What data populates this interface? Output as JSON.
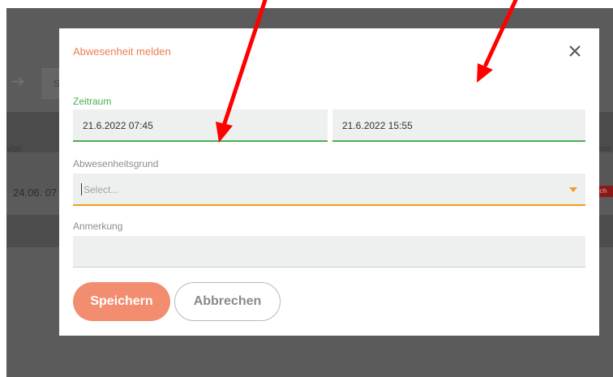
{
  "background": {
    "row_label_von": "Von",
    "row_date": "24.06. 07",
    "box_char": "S",
    "right_col": "atus",
    "badge": "ich"
  },
  "modal": {
    "title": "Abwesenheit melden",
    "period": {
      "label": "Zeitraum",
      "from_value": "21.6.2022 07:45",
      "to_value": "21.6.2022 15:55"
    },
    "reason": {
      "label": "Abwesenheitsgrund",
      "placeholder": "Select..."
    },
    "note": {
      "label": "Anmerkung",
      "value": ""
    },
    "buttons": {
      "save": "Speichern",
      "cancel": "Abbrechen"
    }
  },
  "colors": {
    "accent_orange": "#ee7b52",
    "focus_green": "#4caf50",
    "select_orange": "#f39c1f",
    "annotation_red": "#ff0000",
    "overlay_gray": "#5b5b5b"
  },
  "icons": {
    "close": "close-icon",
    "dropdown": "chevron-down-icon"
  }
}
